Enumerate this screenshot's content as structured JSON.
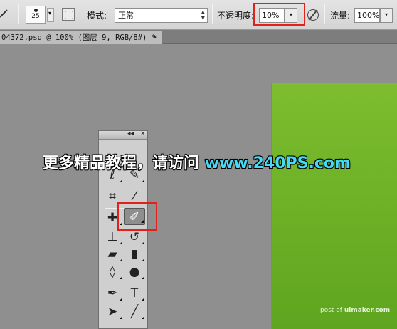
{
  "options_bar": {
    "tool_preset_icon": "brush-tool-icon",
    "brush_size": "25",
    "brush_panel_icon": "brush-panel-icon",
    "mode_label": "模式:",
    "mode_value": "正常",
    "opacity_label": "不透明度:",
    "opacity_value": "10%",
    "opacity_dropdown": "▾",
    "airbrush_icon": "airbrush-icon",
    "flow_label": "流量:",
    "flow_value": "100%"
  },
  "doc_tab": {
    "title": "04372.psd @ 100% (图层 9, RGB/8#) *",
    "close": "×"
  },
  "toolbox": {
    "collapse": "◂◂",
    "close": "×",
    "tools": [
      {
        "name": "lasso-icon",
        "glyph": "ℓ"
      },
      {
        "name": "quick-selection-icon",
        "glyph": "✎"
      },
      {
        "name": "crop-icon",
        "glyph": "⌗"
      },
      {
        "name": "eyedropper-icon",
        "glyph": "⁄"
      },
      {
        "name": "healing-brush-icon",
        "glyph": "✚"
      },
      {
        "name": "brush-icon",
        "glyph": "✐"
      },
      {
        "name": "clone-stamp-icon",
        "glyph": "⊥"
      },
      {
        "name": "history-brush-icon",
        "glyph": "↺"
      },
      {
        "name": "eraser-icon",
        "glyph": "▰"
      },
      {
        "name": "gradient-icon",
        "glyph": "▮"
      },
      {
        "name": "blur-icon",
        "glyph": "◊"
      },
      {
        "name": "dodge-icon",
        "glyph": "●"
      },
      {
        "name": "pen-icon",
        "glyph": "✒"
      },
      {
        "name": "type-icon",
        "glyph": "T"
      },
      {
        "name": "path-selection-icon",
        "glyph": "➤"
      },
      {
        "name": "line-icon",
        "glyph": "╱"
      }
    ]
  },
  "watermark": {
    "text": "更多精品教程，请访问",
    "url": "www.240PS.com",
    "footer_prefix": "post of",
    "footer_site": "uimaker.com"
  },
  "colors": {
    "highlight": "#e1221c",
    "canvas_green_top": "#7dbd2f",
    "canvas_green_bottom": "#5fa51f",
    "workspace": "#8f8f8f"
  }
}
